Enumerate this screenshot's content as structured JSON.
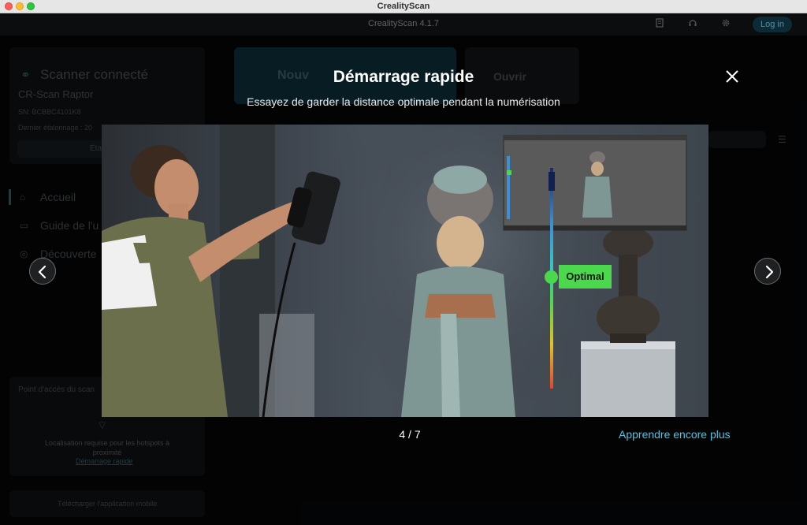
{
  "window": {
    "title": "CrealityScan"
  },
  "header": {
    "version": "CrealityScan 4.1.7",
    "login_label": "Log in"
  },
  "background": {
    "scanner_status": "Scanner connecté",
    "scanner_model": "CR-Scan Raptor",
    "serial": "SN: BCBBC4101K8",
    "calibration": "Dernier étalonnage : 20",
    "calibrate_btn": "Éta",
    "new_btn": "Nouv",
    "open_btn": "Ouvrir",
    "nav": [
      {
        "label": "Accueil"
      },
      {
        "label": "Guide de l'u"
      },
      {
        "label": "Découverte"
      }
    ],
    "hotspot_title": "Point d'accès du scan",
    "hotspot_text": "Localisation requise pour les hotspots à proximité",
    "hotspot_link": "Démarrage rapide",
    "mobile_app": "Télécharger l'application mobile"
  },
  "modal": {
    "title": "Démarrage rapide",
    "subtitle": "Essayez de garder la distance optimale pendant la numérisation",
    "distance_label": "Optimal",
    "page_indicator": "4 / 7",
    "learn_more": "Apprendre encore plus"
  },
  "colors": {
    "accent": "#47c5e6",
    "optimal": "#4cd84c",
    "scale_top": "#3a8fd8",
    "scale_mid": "#4cd84c",
    "scale_bottom": "#e04430"
  }
}
